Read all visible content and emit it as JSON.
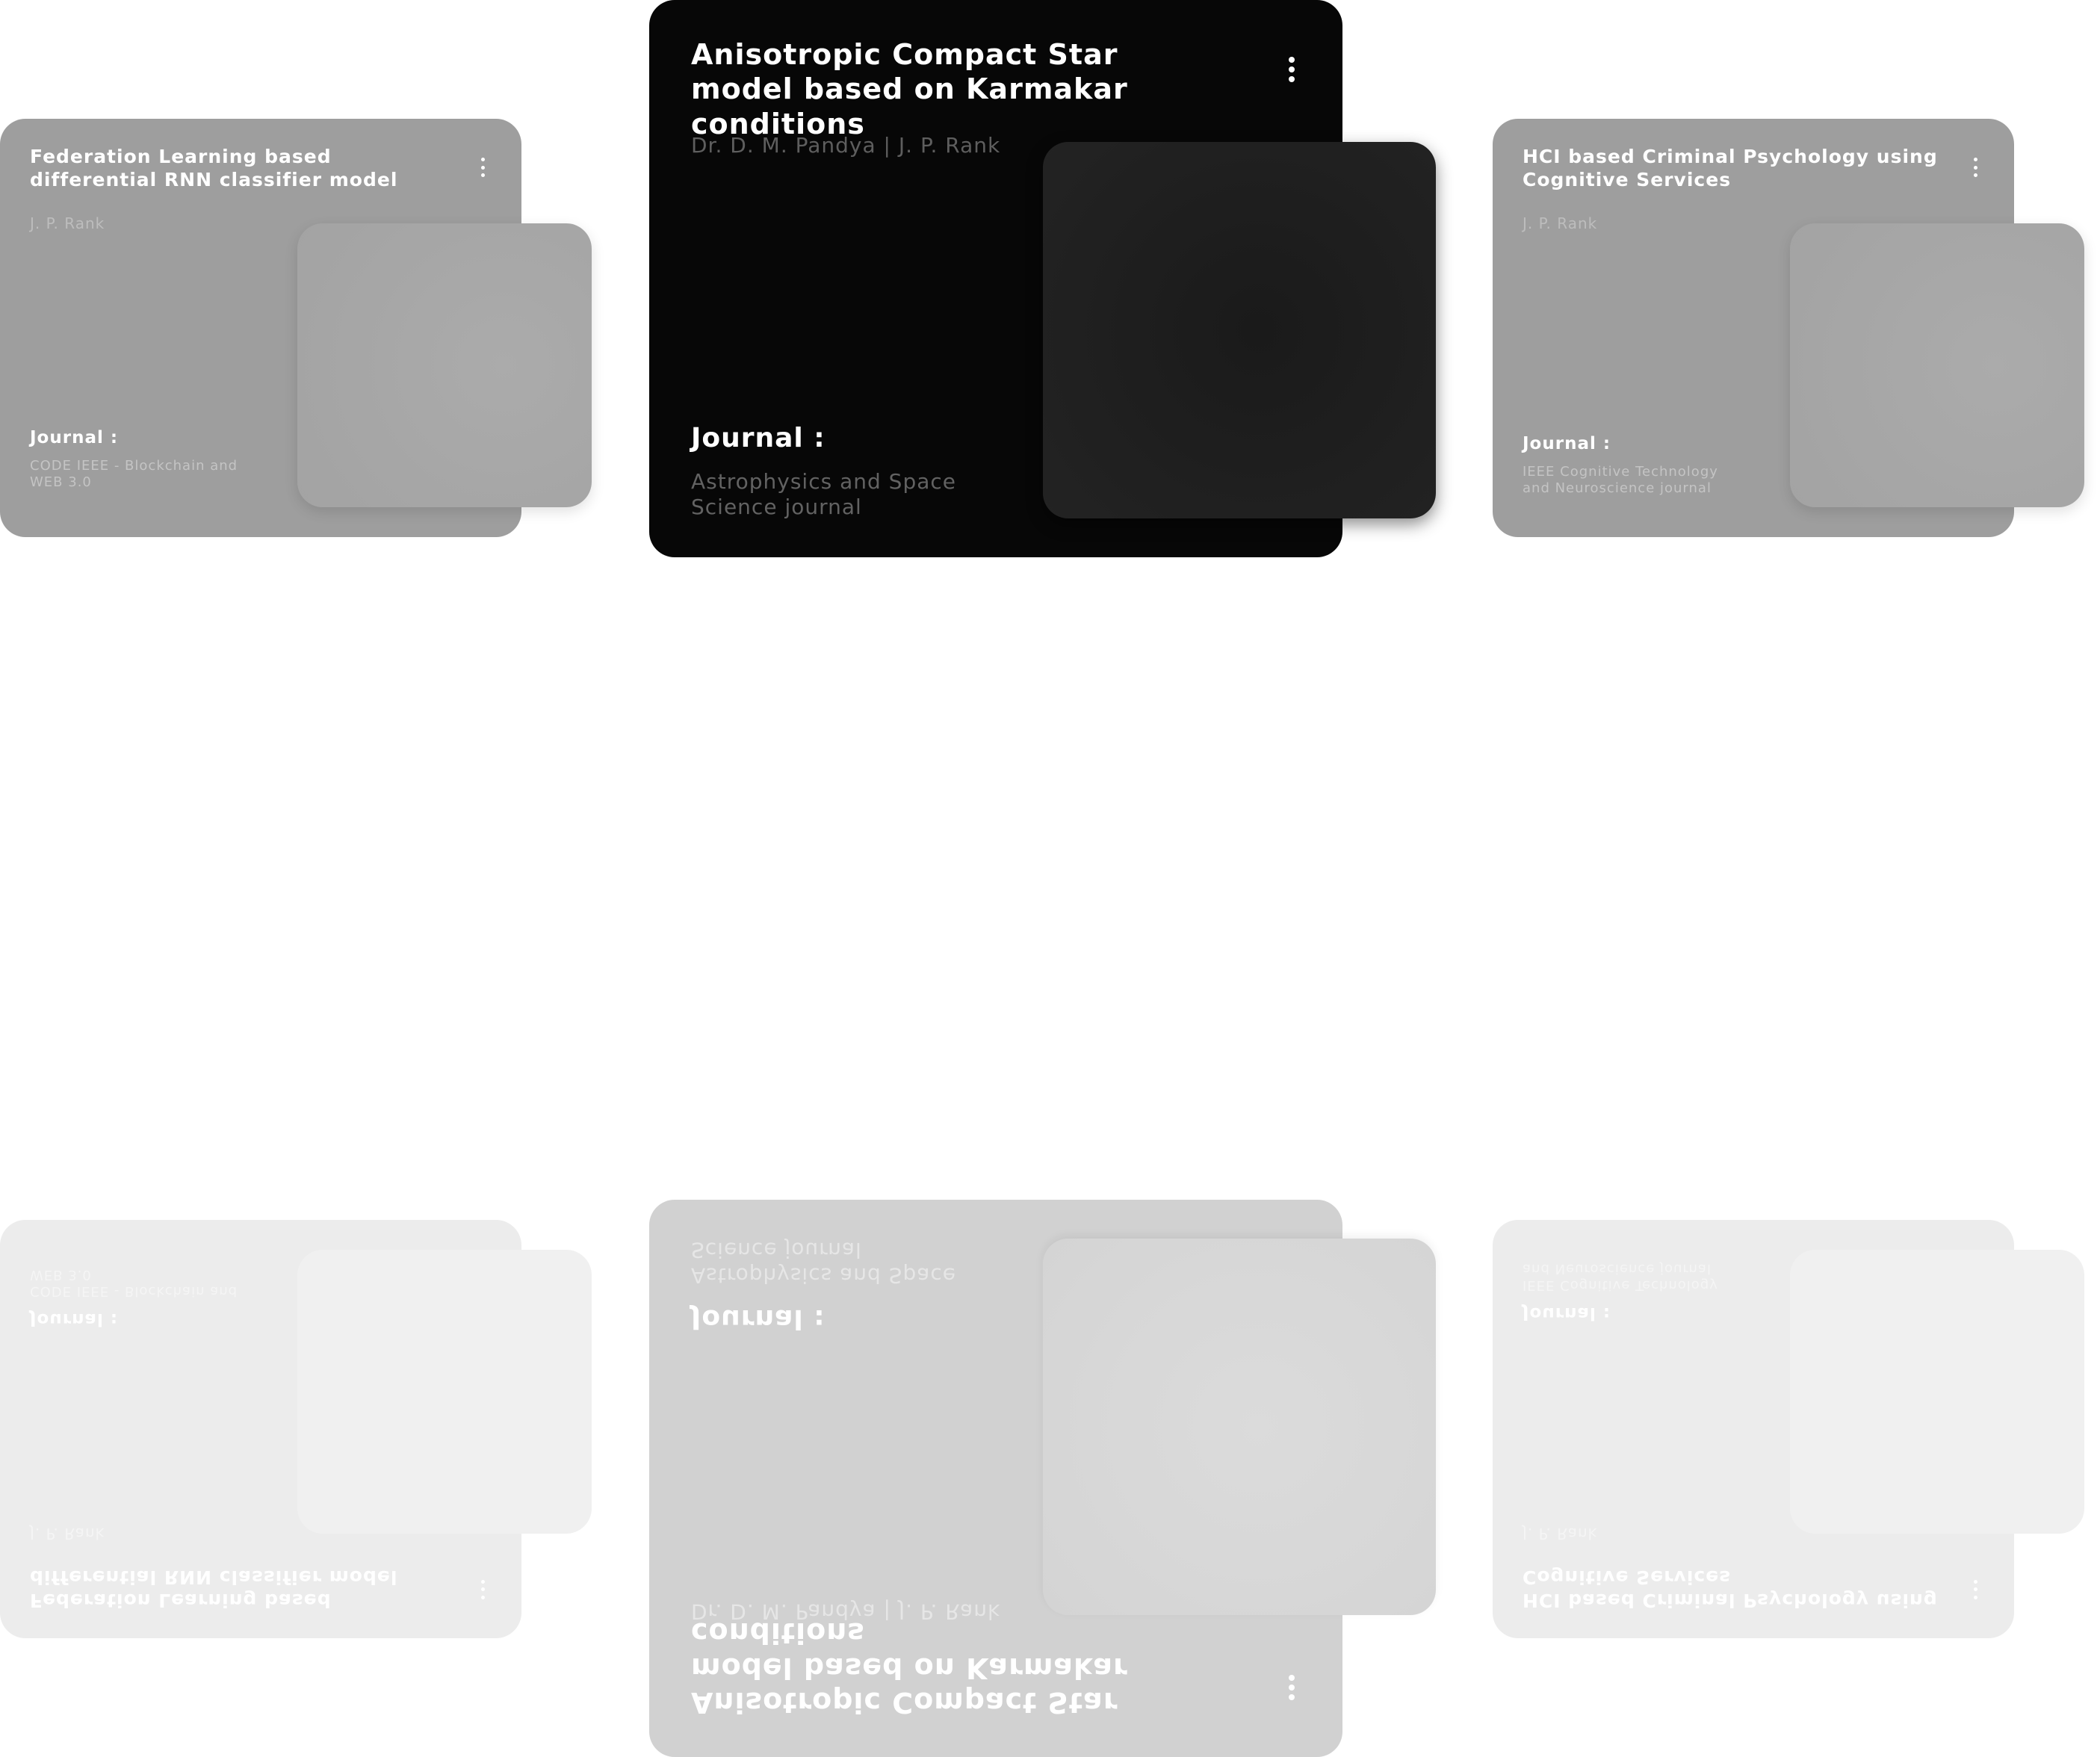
{
  "cards": [
    {
      "title": "Federation Learning based differential RNN classifier model",
      "authors": "J. P. Rank",
      "journal_label": "Journal :",
      "journal": "CODE IEEE - Blockchain and WEB 3.0"
    },
    {
      "title": "Anisotropic Compact Star model based on Karmakar conditions",
      "authors": "Dr. D. M. Pandya | J. P. Rank",
      "journal_label": "Journal :",
      "journal": "Astrophysics and Space Science journal"
    },
    {
      "title": "HCI based Criminal Psychology using Cognitive Services",
      "authors": "J. P. Rank",
      "journal_label": "Journal :",
      "journal": "IEEE Cognitive Technology and Neuroscience journal"
    }
  ],
  "colors": {
    "active_card": "#070707",
    "inactive_card": "#9e9e9e",
    "reflection_side": "#ececec",
    "reflection_center": "#d1d1d1",
    "background": "#ffffff"
  },
  "icons": {
    "menu": "more-vertical-icon"
  }
}
